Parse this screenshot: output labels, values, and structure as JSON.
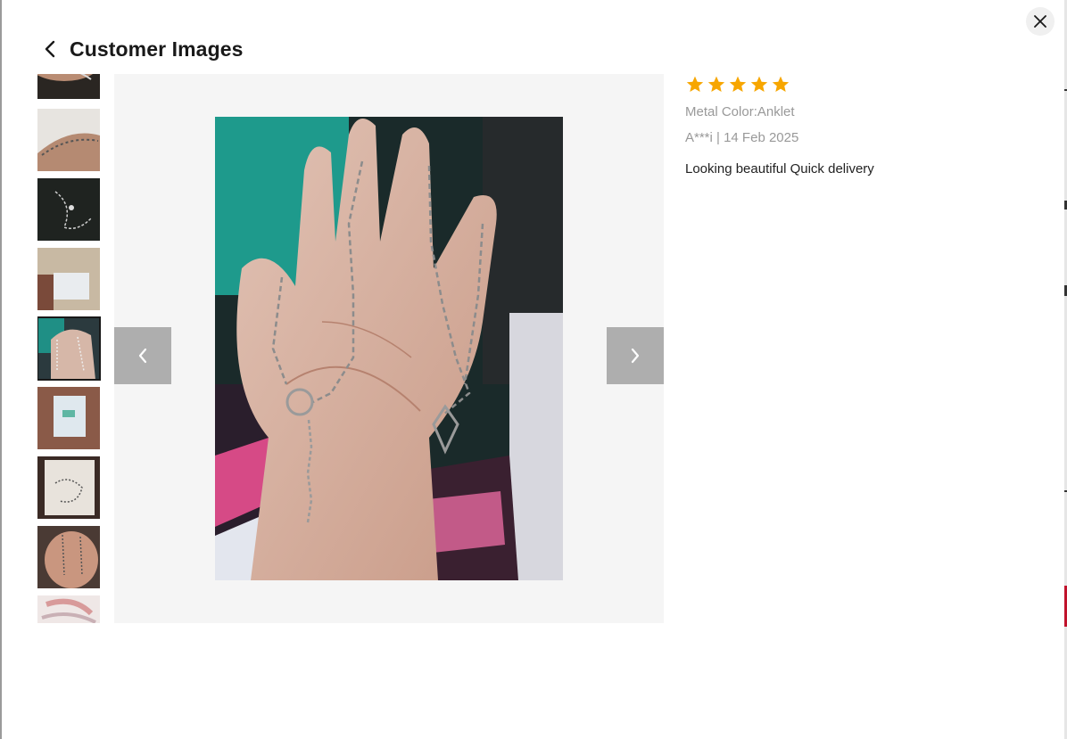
{
  "modal": {
    "title": "Customer Images",
    "back_icon": "chevron-left-icon",
    "close_icon": "close-icon"
  },
  "thumbnails": [
    {
      "name": "thumbnail-1",
      "alt": "bracelet on wrist",
      "active": false
    },
    {
      "name": "thumbnail-2",
      "alt": "bracelet on wrist",
      "active": false
    },
    {
      "name": "thumbnail-3",
      "alt": "anklet on dark fabric",
      "active": false
    },
    {
      "name": "thumbnail-4",
      "alt": "package",
      "active": false
    },
    {
      "name": "thumbnail-5",
      "alt": "anklet on palm",
      "active": true
    },
    {
      "name": "thumbnail-6",
      "alt": "package in hand",
      "active": false
    },
    {
      "name": "thumbnail-7",
      "alt": "anklet on card",
      "active": false
    },
    {
      "name": "thumbnail-8",
      "alt": "anklet on palm",
      "active": false
    },
    {
      "name": "thumbnail-9",
      "alt": "photo",
      "active": false
    }
  ],
  "viewer": {
    "prev_icon": "chevron-left-icon",
    "next_icon": "chevron-right-icon"
  },
  "review": {
    "rating": 5,
    "rating_max": 5,
    "star_color": "#f7a600",
    "attribute": "Metal Color:Anklet",
    "meta": "A***i | 14 Feb 2025",
    "text": "Looking beautiful Quick delivery"
  }
}
